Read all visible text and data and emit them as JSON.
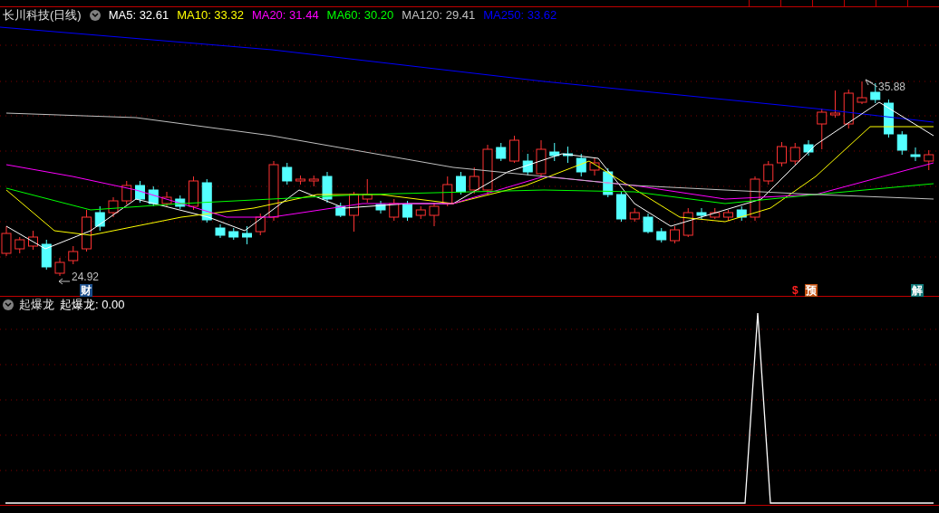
{
  "header": {
    "title": "长川科技(日线)",
    "indicators": [
      {
        "label": "MA5: 32.61",
        "color": "#ffffff"
      },
      {
        "label": "MA10: 33.32",
        "color": "#ffff00"
      },
      {
        "label": "MA20: 31.44",
        "color": "#ff00ff"
      },
      {
        "label": "MA60: 30.20",
        "color": "#00ff00"
      },
      {
        "label": "MA120: 29.41",
        "color": "#c0c0c0"
      },
      {
        "label": "MA250: 33.62",
        "color": "#0000ff"
      }
    ]
  },
  "price_chart": {
    "high_label": "35.88",
    "low_label": "24.92",
    "event_tags": [
      {
        "text": "财",
        "kind": "finance"
      },
      {
        "text": "$",
        "kind": "dollar"
      },
      {
        "text": "预",
        "kind": "forecast"
      },
      {
        "text": "解",
        "kind": "unlock"
      }
    ]
  },
  "indicator_panel": {
    "name": "起爆龙",
    "readings": [
      {
        "label": "起爆龙: 0.00",
        "color": "#ffffff"
      }
    ]
  }
}
